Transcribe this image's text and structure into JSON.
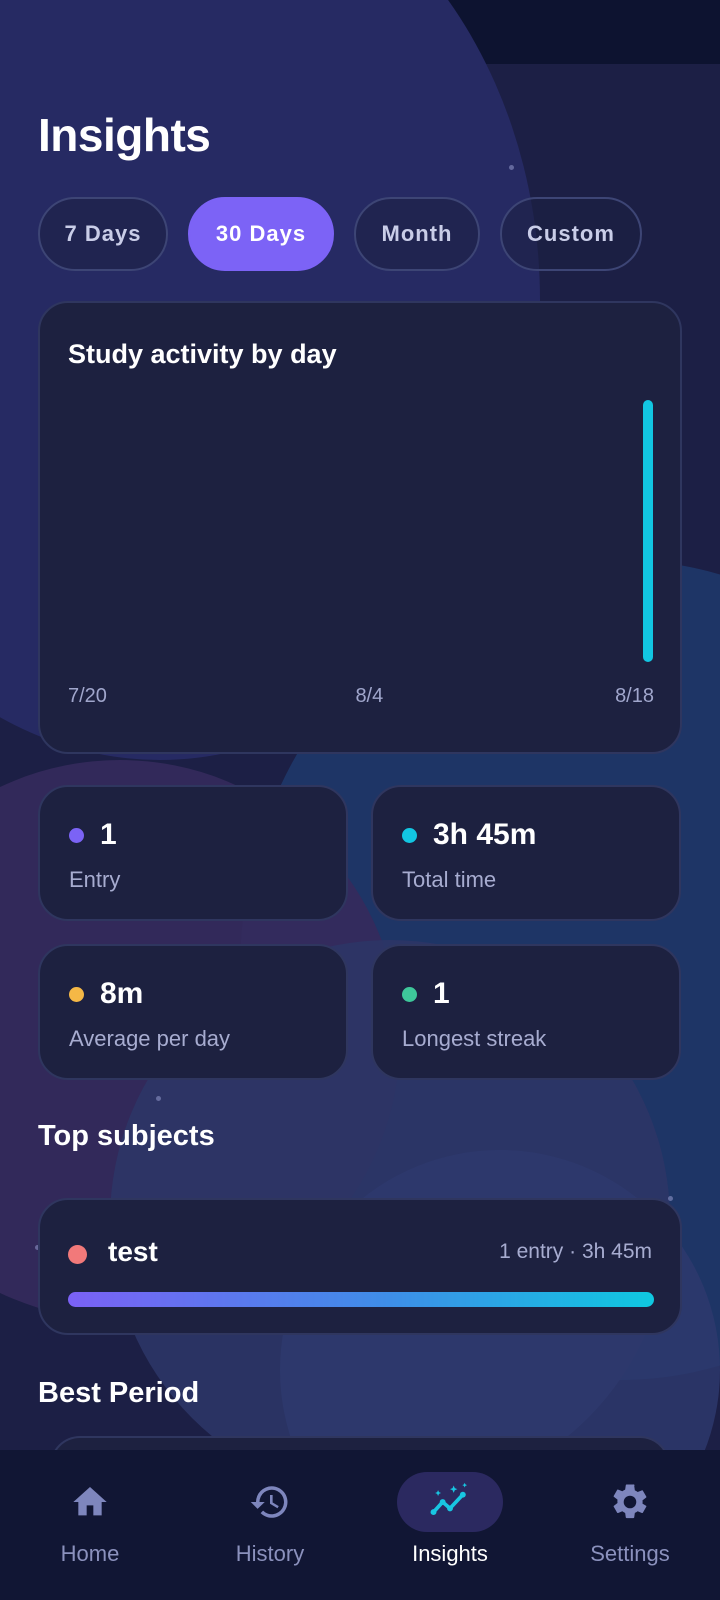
{
  "header": {
    "title": "Insights"
  },
  "range_tabs": [
    {
      "label": "7 Days",
      "active": false
    },
    {
      "label": "30 Days",
      "active": true
    },
    {
      "label": "Month",
      "active": false
    },
    {
      "label": "Custom",
      "active": false
    }
  ],
  "chart": {
    "title": "Study activity by day",
    "bar_color": "#12c6e2"
  },
  "chart_data": {
    "type": "bar",
    "title": "Study activity by day",
    "xlabel": "",
    "ylabel": "",
    "x_range": [
      "7/20",
      "8/18"
    ],
    "x_tick_labels": [
      "7/20",
      "8/4",
      "8/18"
    ],
    "categories": [
      "8/18"
    ],
    "values": [
      225
    ],
    "value_unit": "minutes",
    "grid": false
  },
  "stats": [
    {
      "value": "1",
      "label": "Entry",
      "dot_color": "#7b63f5"
    },
    {
      "value": "3h 45m",
      "label": "Total time",
      "dot_color": "#12c6e2"
    },
    {
      "value": "8m",
      "label": "Average per day",
      "dot_color": "#f5b846"
    },
    {
      "value": "1",
      "label": "Longest streak",
      "dot_color": "#3ec79a"
    }
  ],
  "top_subjects": {
    "title": "Top subjects",
    "items": [
      {
        "name": "test",
        "meta": "1 entry · 3h 45m",
        "dot_color": "#f2797a",
        "share": 1.0
      }
    ]
  },
  "best_period": {
    "title": "Best Period"
  },
  "nav": {
    "items": [
      {
        "label": "Home",
        "icon": "home-icon",
        "active": false
      },
      {
        "label": "History",
        "icon": "history-icon",
        "active": false
      },
      {
        "label": "Insights",
        "icon": "insights-icon",
        "active": true
      },
      {
        "label": "Settings",
        "icon": "gear-icon",
        "active": false
      }
    ]
  }
}
